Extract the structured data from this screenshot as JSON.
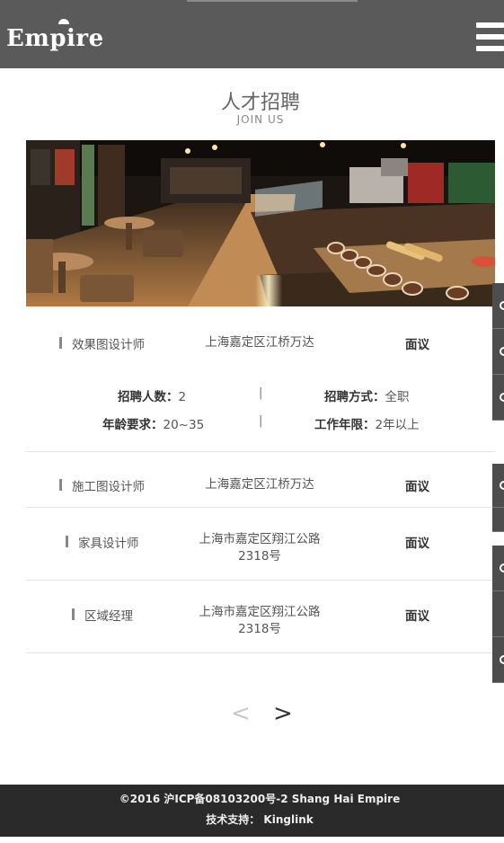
{
  "header": {
    "logo_text": "Empire",
    "menu_icon": "hamburger-menu-icon"
  },
  "section": {
    "title": "人才招聘",
    "subtitle": "JOIN  US"
  },
  "jobs": [
    {
      "title": "效果图设计师",
      "location": "上海嘉定区江桥万达",
      "salary": "面议",
      "details": {
        "count_label": "招聘人数：",
        "count_value": "2",
        "type_label": "招聘方式：",
        "type_value": "全职",
        "age_label": "年龄要求：",
        "age_value": "20~35",
        "exp_label": "工作年限：",
        "exp_value": "2年以上",
        "separator": "|"
      }
    },
    {
      "title": "施工图设计师",
      "location": "上海嘉定区江桥万达",
      "salary": "面议"
    },
    {
      "title": "家具设计师",
      "location_line1": "上海市嘉定区翔江公路",
      "location_line2": "2318号",
      "salary": "面议"
    },
    {
      "title": "区域经理",
      "location_line1": "上海市嘉定区翔江公路",
      "location_line2": "2318号",
      "salary": "面议"
    }
  ],
  "pagination": {
    "prev": "<",
    "next": ">"
  },
  "footer": {
    "line1": "©2016  沪ICP备08103200号-2 Shang  Hai  Empire",
    "line2": "技术支持：  Kinglink"
  },
  "colors": {
    "header_bg": "#5a5a5a",
    "footer_bg": "#2a2a2a",
    "side_tab_bg": "#4d4d4d"
  }
}
